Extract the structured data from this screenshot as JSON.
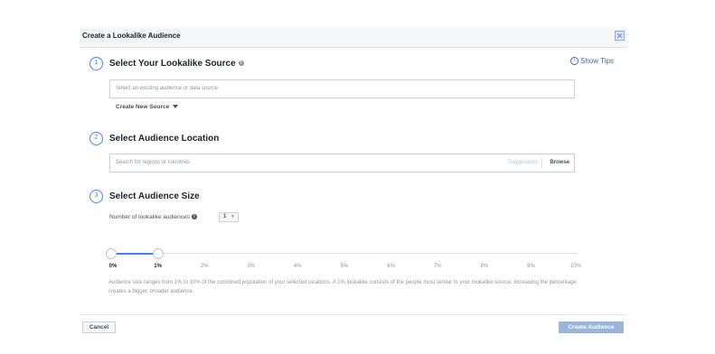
{
  "top_partial_text": "",
  "dialog": {
    "title": "Create a Lookalike Audience",
    "show_tips": "Show Tips",
    "tips_icon": "i",
    "info_icon": "i",
    "steps": [
      {
        "number": "1",
        "title": "Select Your Lookalike Source"
      },
      {
        "number": "2",
        "title": "Select Audience Location"
      },
      {
        "number": "3",
        "title": "Select Audience Size"
      }
    ],
    "source": {
      "placeholder": "Select an existing audience or data source",
      "create_new": "Create New Source"
    },
    "location": {
      "placeholder": "Search for regions or countries",
      "suggestions": "Suggestions",
      "browse": "Browse"
    },
    "size": {
      "num_label": "Number of lookalike audiences",
      "num_value": "1",
      "slider_range": [
        0,
        1
      ],
      "slider_max": 10,
      "ticks": [
        "0%",
        "1%",
        "2%",
        "3%",
        "4%",
        "5%",
        "6%",
        "7%",
        "8%",
        "9%",
        "10%"
      ],
      "description": "Audience size ranges from 1% to 10% of the combined population of your selected locations. A 1% lookalike consists of the people most similar to your lookalike source. Increasing the percentage creates a bigger, broader audience."
    },
    "footer": {
      "cancel": "Cancel",
      "create": "Create Audience"
    }
  },
  "colors": {
    "accent": "#4080ff",
    "link": "#4267b2",
    "disabled_button": "#9cb4d8"
  }
}
